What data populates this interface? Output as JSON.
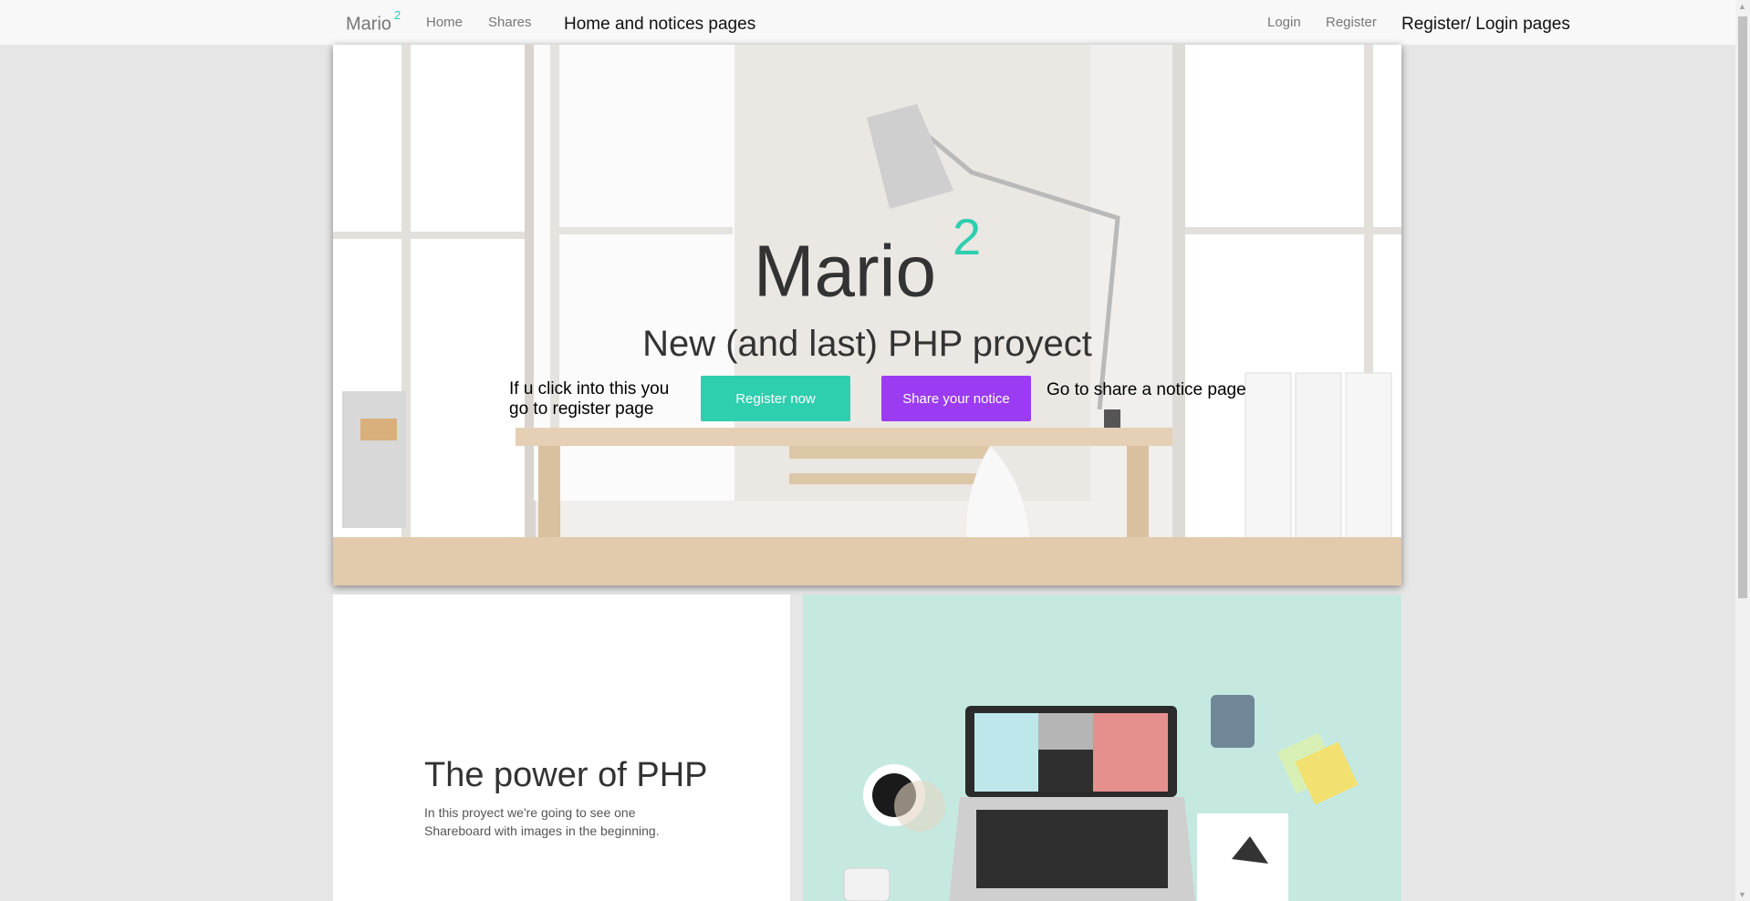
{
  "navbar": {
    "brand": "Mario",
    "brand_sup": "2",
    "links": [
      "Home",
      "Shares"
    ],
    "annotation_left": "Home and notices pages",
    "auth_links": [
      "Login",
      "Register"
    ],
    "annotation_right": "Register/ Login pages"
  },
  "hero": {
    "title": "Mario",
    "title_sup": "2",
    "subtitle": "New (and last) PHP proyect",
    "note_left_line1": "If u click into this you",
    "note_left_line2": "go to register page",
    "register_button": "Register now",
    "share_button": "Share your notice",
    "note_right": "Go to share a notice page"
  },
  "feature": {
    "title": "The power of PHP",
    "text_line1": "In this proyect we're going to see one",
    "text_line2": "Shareboard with images in the beginning."
  },
  "colors": {
    "accent_green": "#2ecfae",
    "accent_purple": "#9b3cf2",
    "page_bg": "#e6e6e6"
  },
  "icons": {
    "scroll_up": "triangle-up-icon",
    "scroll_down": "triangle-down-icon"
  }
}
